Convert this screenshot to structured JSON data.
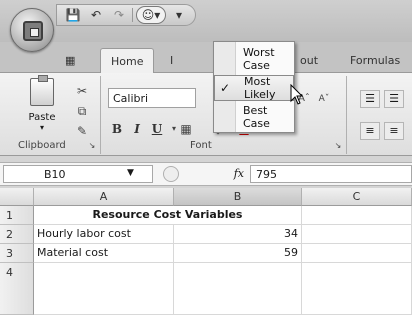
{
  "quick_access": {
    "icons": [
      "save-icon",
      "undo-icon",
      "redo-icon",
      "scenario-icon",
      "customize-icon"
    ]
  },
  "tabs": [
    {
      "label": "Home"
    },
    {
      "label": "I"
    },
    {
      "label": "out"
    },
    {
      "label": "Formulas"
    }
  ],
  "scenario_menu": {
    "items": [
      {
        "label": "Worst Case",
        "checked": false
      },
      {
        "label": "Most Likely",
        "checked": true
      },
      {
        "label": "Best Case",
        "checked": false
      }
    ],
    "checkmark": "✓"
  },
  "ribbon": {
    "paste_label": "Paste",
    "font_name": "Calibri",
    "bold": "B",
    "italic": "I",
    "underline": "U",
    "font_color": "A",
    "groups": {
      "clipboard": "Clipboard",
      "font": "Font"
    }
  },
  "formula_bar": {
    "name_box": "B10",
    "fx": "fx",
    "value": "795"
  },
  "sheet": {
    "columns": [
      "A",
      "B",
      "C"
    ],
    "rows": [
      {
        "num": "1",
        "a": "Resource Cost Variables",
        "b": "",
        "c": ""
      },
      {
        "num": "2",
        "a": "Hourly labor cost",
        "b": "34",
        "c": ""
      },
      {
        "num": "3",
        "a": "Material cost",
        "b": "59",
        "c": ""
      },
      {
        "num": "4",
        "a": "",
        "b": "",
        "c": ""
      }
    ]
  }
}
